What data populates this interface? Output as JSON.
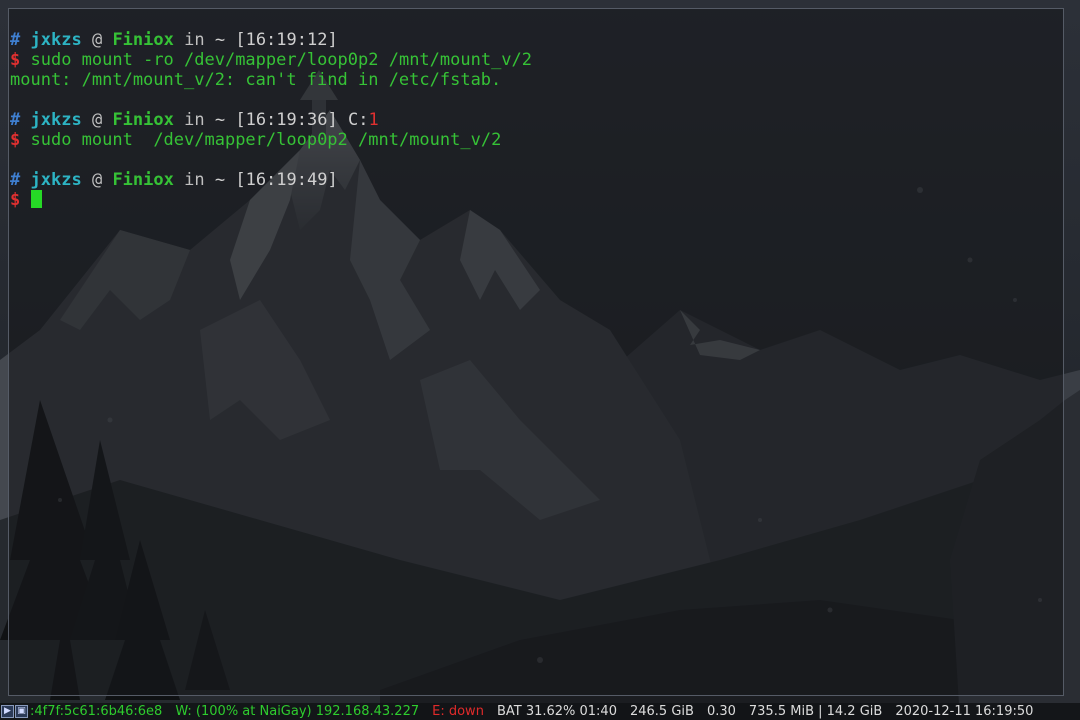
{
  "terminal": {
    "blocks": [
      {
        "prompt": {
          "hash": "#",
          "user": "jxkzs",
          "at": "@",
          "host": "Finiox",
          "in": "in",
          "path": "~",
          "time": "[16:19:12]"
        },
        "command": {
          "dollar": "$",
          "text": "sudo mount -ro /dev/mapper/loop0p2 /mnt/mount_v/2"
        },
        "output": "mount: /mnt/mount_v/2: can't find in /etc/fstab."
      },
      {
        "prompt": {
          "hash": "#",
          "user": "jxkzs",
          "at": "@",
          "host": "Finiox",
          "in": "in",
          "path": "~",
          "time": "[16:19:36]",
          "code_label": "C:",
          "code_value": "1"
        },
        "command": {
          "dollar": "$",
          "text": "sudo mount  /dev/mapper/loop0p2 /mnt/mount_v/2"
        }
      },
      {
        "prompt": {
          "hash": "#",
          "user": "jxkzs",
          "at": "@",
          "host": "Finiox",
          "in": "in",
          "path": "~",
          "time": "[16:19:49]"
        },
        "command": {
          "dollar": "$",
          "text": ""
        }
      }
    ]
  },
  "statusbar": {
    "ipv6": ":4f7f:5c61:6b46:6e8",
    "wifi": "W: (100% at NaiGay) 192.168.43.227",
    "ethernet": "E: down",
    "battery": "BAT 31.62% 01:40",
    "disk": "246.5 GiB",
    "load": "0.30",
    "memory": "735.5 MiB | 14.2 GiB",
    "datetime": "2020-12-11 16:19:50"
  },
  "colors": {
    "prompt_user": "#2db4c4",
    "prompt_host": "#36c236",
    "prompt_hash": "#3f7fd0",
    "dollar_sign": "#e03030",
    "command_text": "#36c236",
    "cursor": "#26d926",
    "status_ok": "#2ecc2e",
    "status_bad": "#e02a2a",
    "status_info": "#dcdcdc"
  },
  "icons": [
    "terminal-tray-icon",
    "window-tray-icon"
  ]
}
